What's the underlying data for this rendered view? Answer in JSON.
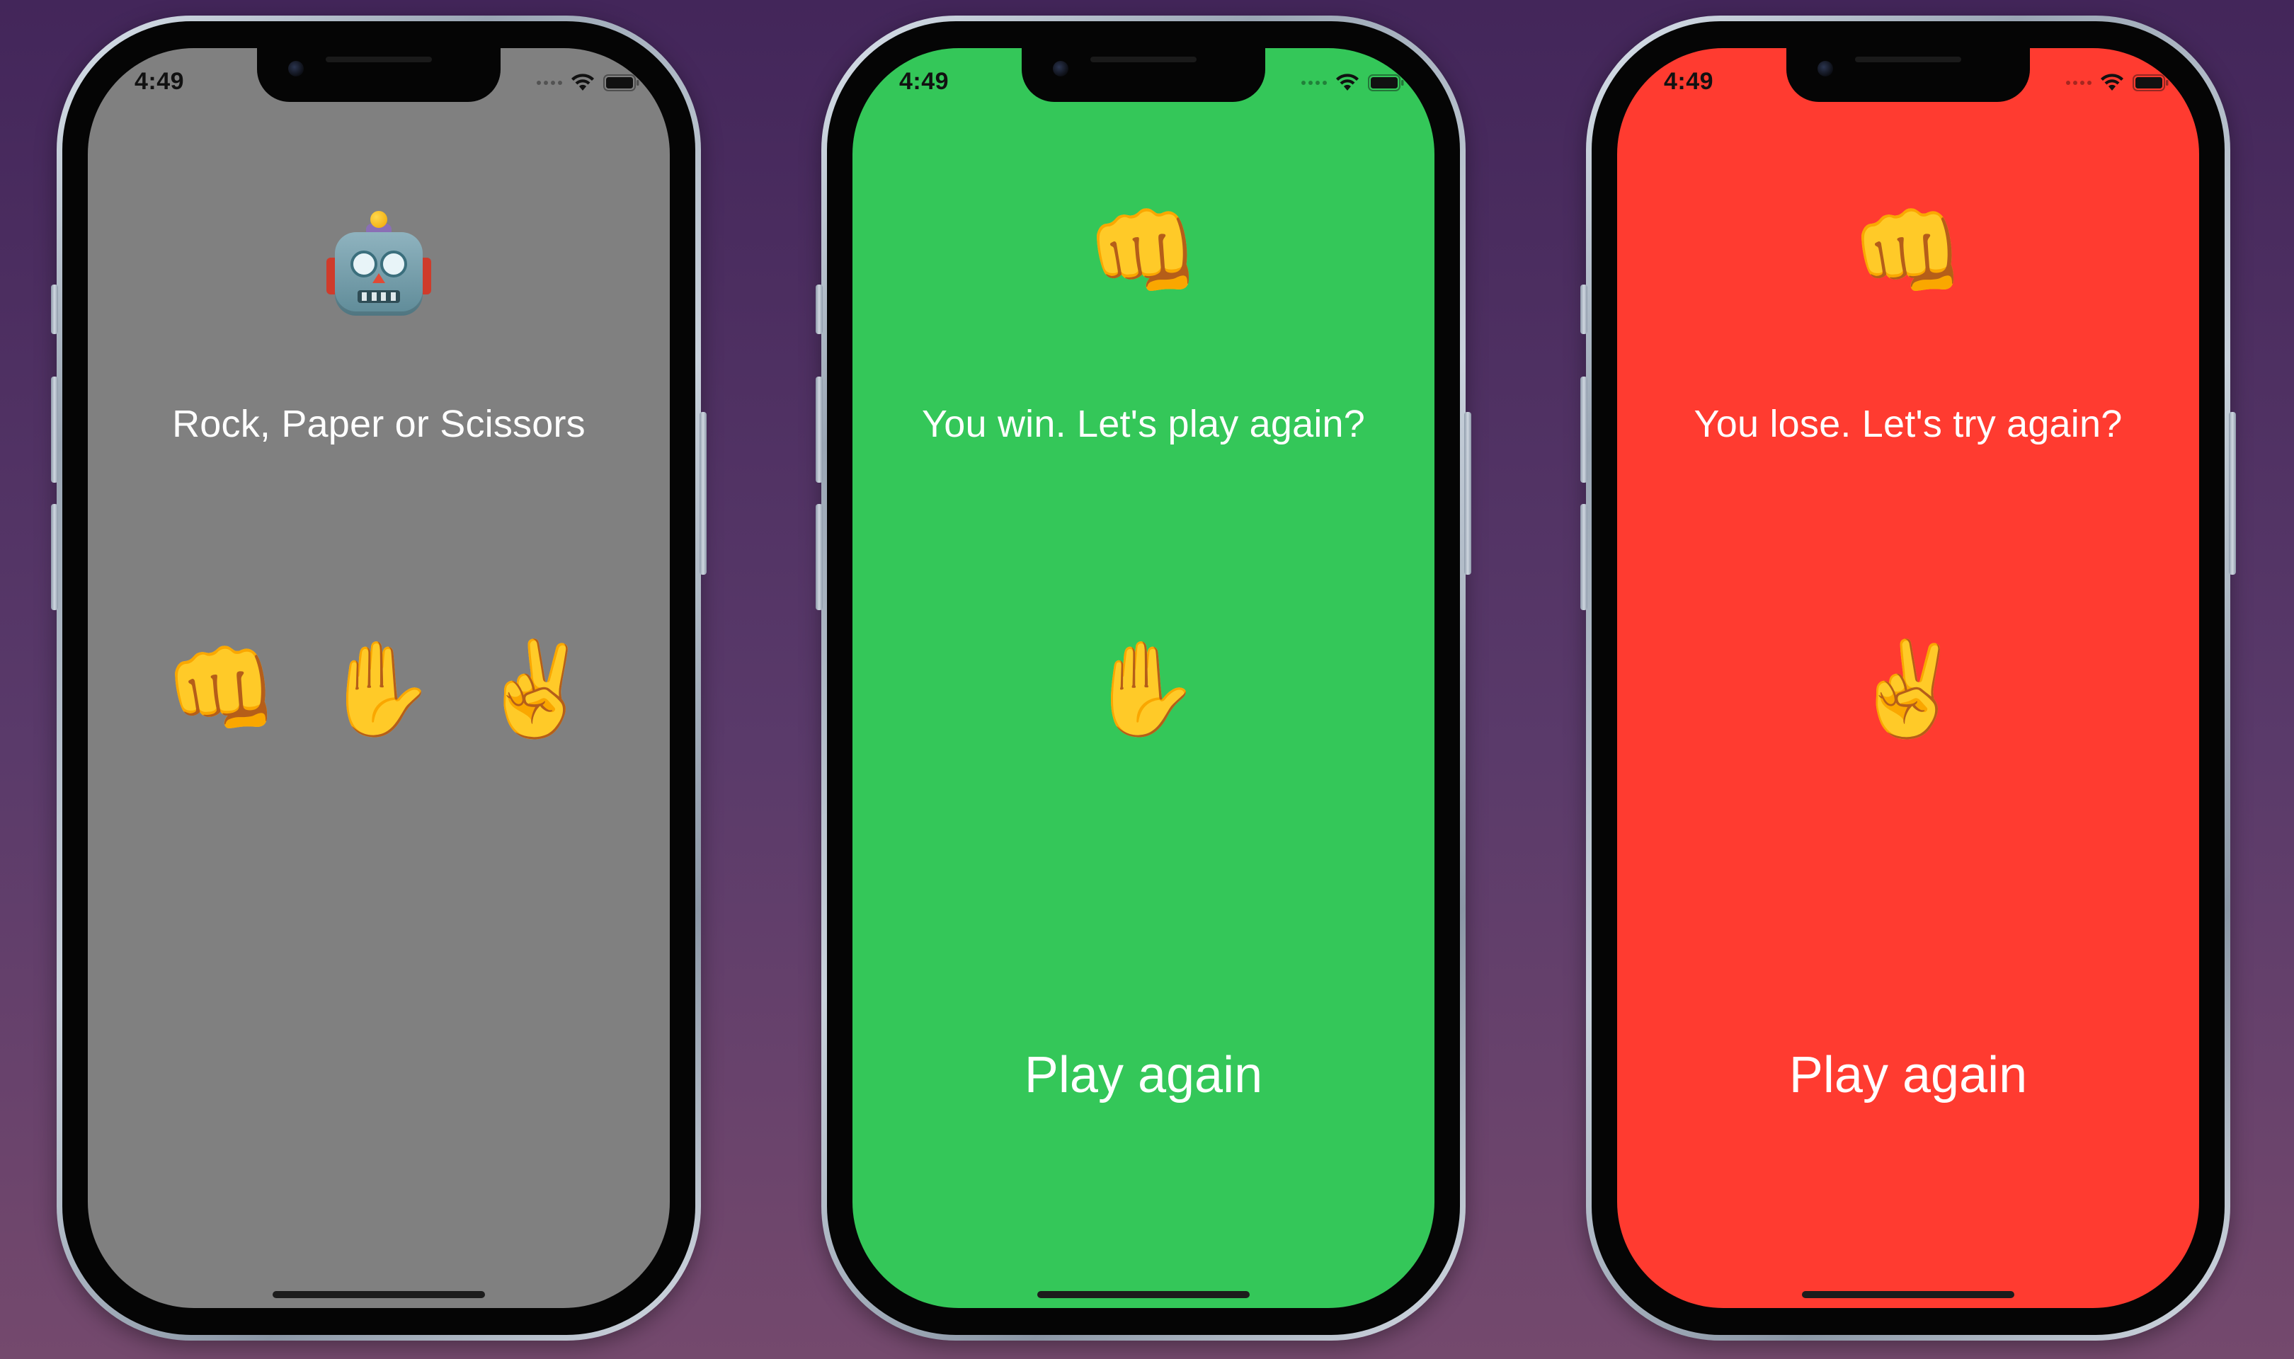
{
  "screens": [
    {
      "id": "start",
      "status_time": "4:49",
      "background": "#808080",
      "top_icon": "robot",
      "top_emoji": "",
      "message": "Rock, Paper or Scissors",
      "choices": [
        "👊",
        "✋",
        "✌️"
      ],
      "play_again": ""
    },
    {
      "id": "win",
      "status_time": "4:49",
      "background": "#34c759",
      "top_icon": "",
      "top_emoji": "👊",
      "message": "You win. Let's play again?",
      "choices": [
        "✋"
      ],
      "play_again": "Play again"
    },
    {
      "id": "lose",
      "status_time": "4:49",
      "background": "#ff3b30",
      "top_icon": "",
      "top_emoji": "👊",
      "message": "You lose. Let's try again?",
      "choices": [
        "✌️"
      ],
      "play_again": "Play again"
    }
  ],
  "colors": {
    "backdrop_top": "#43265a",
    "backdrop_bottom": "#74496d",
    "text": "#ffffff"
  }
}
